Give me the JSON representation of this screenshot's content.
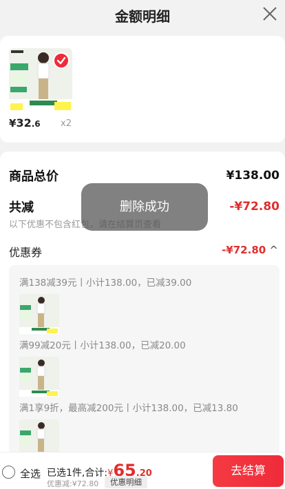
{
  "header": {
    "title": "金额明细",
    "close_icon": "close-icon"
  },
  "product": {
    "currency": "¥",
    "price_int": "32",
    "price_dec": ".6",
    "quantity": "x2",
    "selected": true
  },
  "detail": {
    "goods_total_label": "商品总价",
    "goods_total_value": "¥138.00",
    "total_discount_label": "共减",
    "total_discount_value": "-¥72.80",
    "note": "以下优惠不包含红包，请在结算页查看",
    "coupon_label": "优惠券",
    "coupon_value": "-¥72.80",
    "coupon_arrow": "^",
    "promotions": [
      {
        "text": "满138减39元丨小计138.00，已减39.00"
      },
      {
        "text": "满99减20元丨小计138.00，已减20.00"
      },
      {
        "text": "满1享9折，最高减200元丨小计138.00，已减13.80"
      }
    ]
  },
  "toast": {
    "text": "删除成功"
  },
  "footer": {
    "select_all_label": "全选",
    "summary_text": "已选1件,合计:",
    "total_currency": "¥",
    "total_int": "65",
    "total_dec": ".20",
    "discount_text": "优惠减:¥72.80",
    "detail_chip": "优惠明细",
    "checkout_label": "去结算"
  },
  "colors": {
    "accent": "#ef2b3a",
    "discount": "#e02e2e"
  }
}
